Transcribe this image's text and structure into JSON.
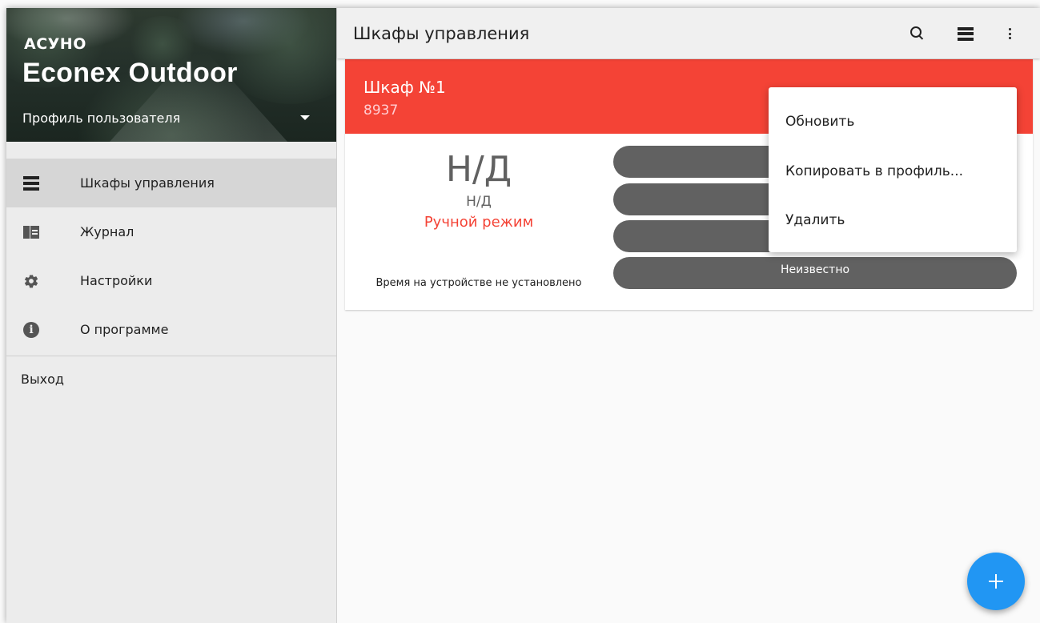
{
  "drawer": {
    "brand_small": "АСУНО",
    "brand_large": "Econex Outdoor",
    "profile_label": "Профиль пользователя",
    "items": [
      {
        "label": "Шкафы управления",
        "icon": "list-icon",
        "active": true
      },
      {
        "label": "Журнал",
        "icon": "journal-icon",
        "active": false
      },
      {
        "label": "Настройки",
        "icon": "gear-icon",
        "active": false
      },
      {
        "label": "О программе",
        "icon": "info-icon",
        "active": false
      }
    ],
    "logout_label": "Выход"
  },
  "appbar": {
    "title": "Шкафы управления",
    "actions": [
      "search-icon",
      "view-list-icon",
      "more-vert-icon"
    ]
  },
  "card": {
    "title": "Шкаф №1",
    "subtitle": "8937",
    "status_big": "Н/Д",
    "status_small": "Н/Д",
    "mode": "Ручной режим",
    "time_note": "Время на устройстве не установлено",
    "pills": [
      "",
      "",
      "",
      "Неизвестно"
    ],
    "header_color": "#f44336"
  },
  "menu": {
    "items": [
      "Обновить",
      "Копировать в профиль...",
      "Удалить"
    ]
  },
  "fab": {
    "icon": "plus-icon",
    "color": "#2196f3"
  }
}
